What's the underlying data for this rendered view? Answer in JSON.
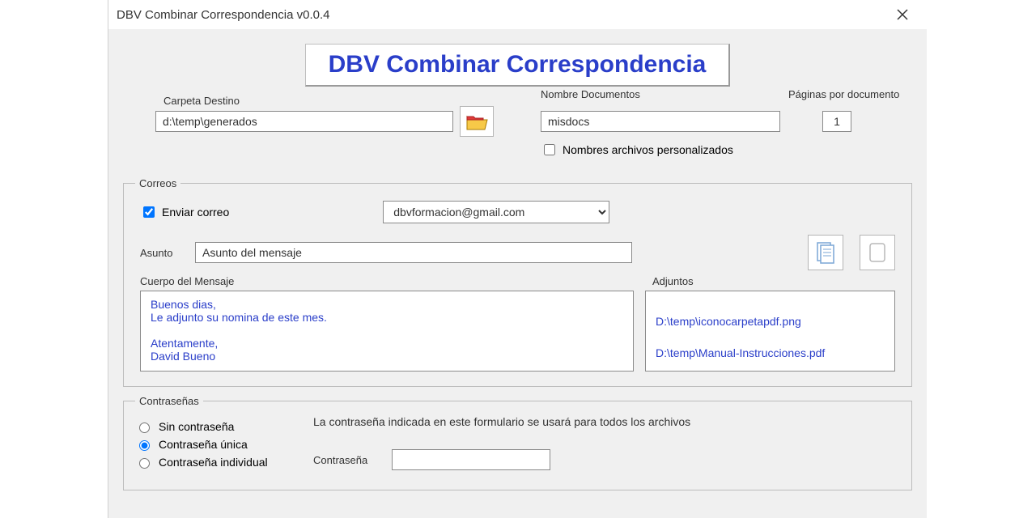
{
  "window": {
    "title": "DBV Combinar Correspondencia v0.0.4"
  },
  "banner": "DBV Combinar Correspondencia",
  "dest": {
    "label": "Carpeta Destino",
    "value": "d:\\temp\\generados"
  },
  "docname": {
    "label": "Nombre Documentos",
    "value": "misdocs"
  },
  "pages": {
    "label": "Páginas por documento",
    "value": "1"
  },
  "custom_names": {
    "label": "Nombres archivos personalizados",
    "checked": false
  },
  "mail": {
    "legend": "Correos",
    "send_label": "Enviar correo",
    "send_checked": true,
    "account": "dbvformacion@gmail.com",
    "subject_label": "Asunto",
    "subject_value": "Asunto del mensaje",
    "body_label": "Cuerpo del Mensaje",
    "body_text": "Buenos dias,\nLe adjunto su nomina de este mes.\n\nAtentamente,\nDavid Bueno",
    "attach_label": "Adjuntos",
    "attachments": [
      "D:\\temp\\iconocarpetapdf.png",
      "D:\\temp\\Manual-Instrucciones.pdf"
    ]
  },
  "pwd": {
    "legend": "Contraseñas",
    "hint": "La contraseña indicada en este formulario se usará para todos los archivos",
    "opt_none": "Sin contraseña",
    "opt_single": "Contraseña única",
    "opt_individual": "Contraseña individual",
    "selected": "single",
    "field_label": "Contraseña",
    "field_value": ""
  }
}
